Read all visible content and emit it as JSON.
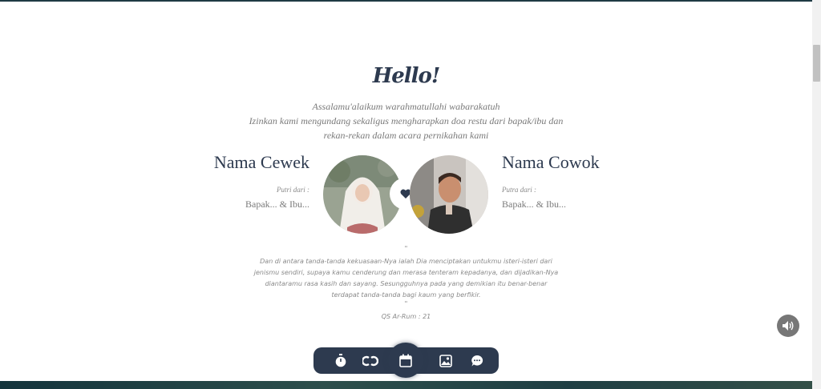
{
  "intro": {
    "title": "Hello!",
    "line1": "Assalamu'alaikum warahmatullahi wabarakatuh",
    "line2": "Izinkan kami mengundang sekaligus mengharapkan doa restu dari bapak/ibu dan",
    "line3": "rekan-rekan dalam acara pernikahan kami"
  },
  "bride": {
    "name": "Nama Cewek",
    "label": "Putri dari :",
    "parents": "Bapak... & Ibu..."
  },
  "groom": {
    "name": "Nama Cowok",
    "label": "Putra dari :",
    "parents": "Bapak... & Ibu..."
  },
  "verse": {
    "open_quote": "\"",
    "lines": [
      "Dan di antara tanda-tanda kekuasaan-Nya ialah Dia menciptakan untukmu isteri-isteri dari",
      "jenismu sendiri, supaya kamu cenderung dan merasa tenteram kepadanya, dan dijadikan-Nya",
      "diantaramu rasa kasih dan sayang. Sesungguhnya pada yang demikian itu benar-benar",
      "terdapat tanda-tanda bagi kaum yang berfikir."
    ],
    "close_quote": "\"",
    "source": "QS Ar-Rum : 21"
  },
  "icons": {
    "heart": "heart-icon",
    "speaker": "speaker-icon",
    "nav": [
      "stopwatch-icon",
      "couple-icon",
      "calendar-icon",
      "gallery-icon",
      "chat-icon"
    ]
  },
  "colors": {
    "navy": "#2d3a4f",
    "text_gray": "#7a7a7a"
  }
}
